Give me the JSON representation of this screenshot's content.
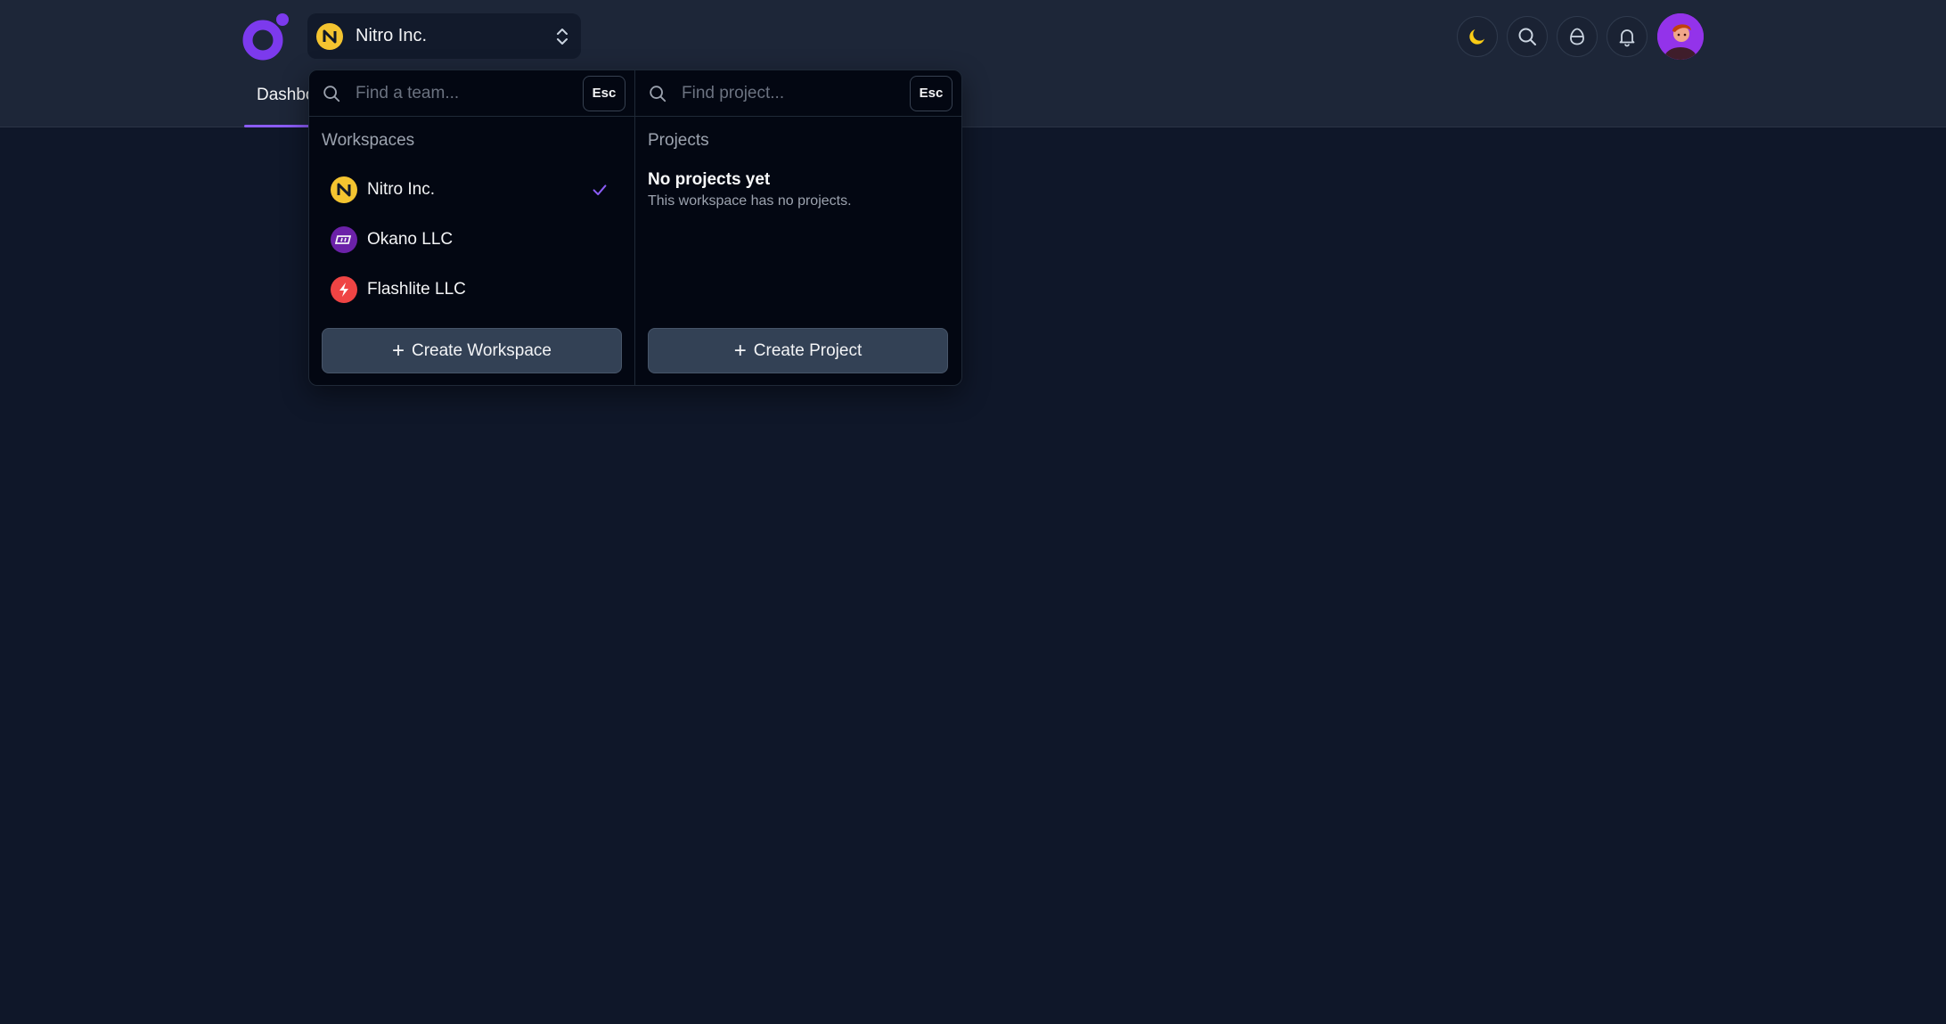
{
  "header": {
    "current_workspace": "Nitro Inc.",
    "nav_tab_label": "Dashboard"
  },
  "icons": {
    "theme": "moon-icon",
    "search": "search-icon",
    "shield": "drop-icon",
    "notifications": "bell-icon"
  },
  "colors": {
    "accent": "#8b5cf6",
    "moon": "#facc15",
    "nitro": "#f4c430",
    "okano": "#6b21a8",
    "flashlite": "#ef4444"
  },
  "workspaces_panel": {
    "search_placeholder": "Find a team...",
    "esc_label": "Esc",
    "section_title": "Workspaces",
    "items": [
      {
        "label": "Nitro Inc.",
        "selected": true
      },
      {
        "label": "Okano LLC",
        "selected": false
      },
      {
        "label": "Flashlite LLC",
        "selected": false
      }
    ],
    "create_label": "Create Workspace"
  },
  "projects_panel": {
    "search_placeholder": "Find project...",
    "esc_label": "Esc",
    "section_title": "Projects",
    "empty_heading": "No projects yet",
    "empty_description": "This workspace has no projects.",
    "create_label": "Create Project"
  }
}
